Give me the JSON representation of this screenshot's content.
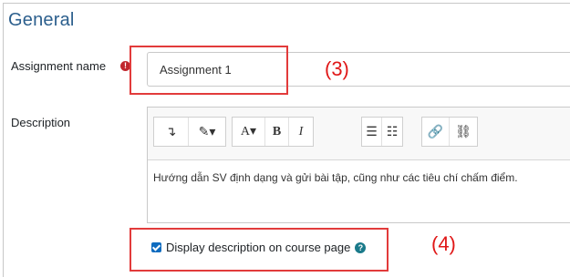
{
  "section": {
    "title": "General"
  },
  "assignment_name": {
    "label": "Assignment name",
    "required_icon": "exclamation-icon",
    "required_glyph": "!",
    "value": "Assignment 1",
    "annotation": "(3)"
  },
  "description": {
    "label": "Description",
    "toolbar": {
      "group1": [
        "↴",
        "✎▾"
      ],
      "group2": [
        "A▾",
        "B",
        "I"
      ],
      "group3": [
        "☰",
        "☷"
      ],
      "group4": [
        "🔗",
        "⛓"
      ]
    },
    "content": "Hướng dẫn SV định dạng và gửi bài tập, cũng như các tiêu chí chấm điểm."
  },
  "display_description": {
    "label": "Display description on course page",
    "checked": true,
    "help_glyph": "?",
    "annotation": "(4)"
  },
  "colors": {
    "title": "#2c5f8d",
    "annotation": "#e01818",
    "checkbox": "#0f6cbf"
  }
}
